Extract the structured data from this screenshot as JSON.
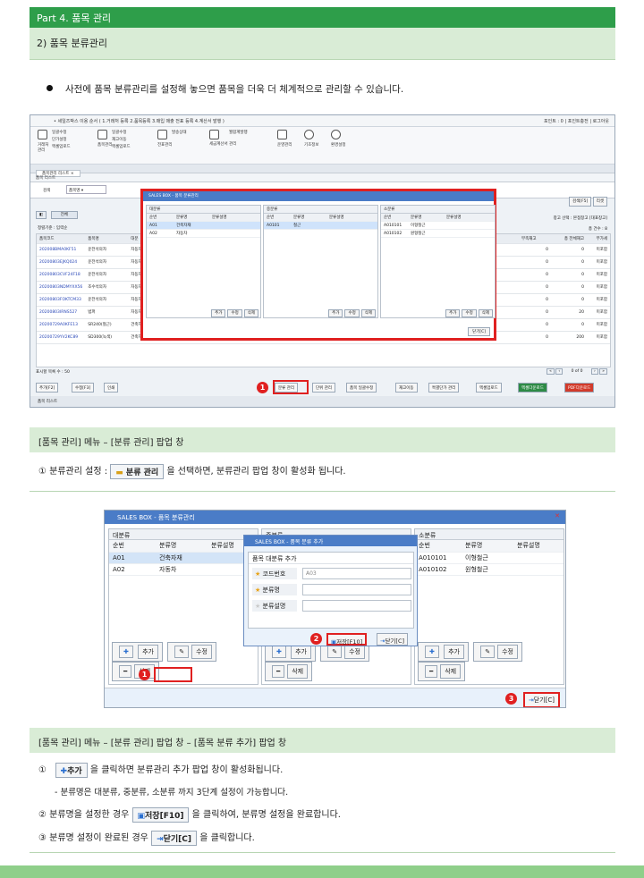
{
  "header": {
    "part_title": "Part 4. 품목 관리",
    "section_title": "2) 품목 분류관리"
  },
  "intro": "사전에 품목 분류관리를 설정해 놓으면 품목을 더욱 더 체계적으로 관리할 수 있습니다.",
  "shot1": {
    "titlebar": "• 세일즈박스 이용 순서 ( 1.거래처 등록 2.품목등록 3.매입 매출 전표 등록 4.계산서 발행 )",
    "titlebar_right": "포인트 : 0  |  포인트충전  |  로그아웃",
    "ribbon": {
      "g1_items": [
        "일괄수정",
        "단가설정",
        "엑셀업로드"
      ],
      "g1_main": "거래처 관리",
      "g2_items": [
        "일괄수정",
        "재고이동",
        "엑셀업로드"
      ],
      "g2_main": "품목관리",
      "g3_main": "전표관리",
      "g3_extra": "발송상태",
      "g4_main": "세금계산서 관리",
      "g4_extra": "월합계발행",
      "g5_main": "운영관리",
      "g6_main": "기초정보",
      "g7_main": "환경설정",
      "labels": [
        "거래처 관리",
        "품목관리",
        "전표관리",
        "세금계산서관리",
        "운영관리",
        "기초정보",
        "환경설정"
      ]
    },
    "tab": "품목관리 리스트",
    "list_head": "품목 리스트",
    "search_label": "검색",
    "search_value": "품목명",
    "all_button": "전체",
    "sort_label": "정렬기준 : 입력순",
    "search_button": "검색[F5]",
    "reset_button": "리셋",
    "warehouse_label": "창고 선택 : 본점창고 [대표창고]",
    "total_label": "총 건수 : 8",
    "grid_headers": [
      "품목코드",
      "품목명",
      "대분"
    ],
    "grid_right_headers": [
      "부족재고",
      "총 전체재고",
      "부가세"
    ],
    "grid_rows": [
      {
        "code": "202008BMA0KF51",
        "name": "운전석의자",
        "cat": "자동차",
        "short": "0",
        "total": "0",
        "vat": "미포함"
      },
      {
        "code": "20200803EJKQ024",
        "name": "운전석의자",
        "cat": "자동차",
        "short": "0",
        "total": "0",
        "vat": "미포함"
      },
      {
        "code": "20200803CVF24F18",
        "name": "운전석의자",
        "cat": "자동차",
        "short": "0",
        "total": "0",
        "vat": "미포함"
      },
      {
        "code": "20200803NDMYXX56",
        "name": "조수석의자",
        "cat": "자동차",
        "short": "0",
        "total": "0",
        "vat": "미포함"
      },
      {
        "code": "20200803FOKTCM33",
        "name": "운전석의자",
        "cat": "자동차",
        "short": "0",
        "total": "0",
        "vat": "미포함"
      },
      {
        "code": "20200803IRNS527",
        "name": "범퍼",
        "cat": "자동차",
        "short": "0",
        "total": "20",
        "vat": "미포함"
      },
      {
        "code": "20200729A0KFE13",
        "name": "SR240(철근)",
        "cat": "건축자재",
        "short": "0",
        "total": "0",
        "vat": "미포함"
      },
      {
        "code": "20200729YV2KC89",
        "name": "SD300(녹색)",
        "cat": "건축자재",
        "short": "0",
        "total": "200",
        "vat": "미포함"
      }
    ],
    "per_page": "표시할 목록 수 : 50",
    "pager": "0 of 0",
    "bottom_buttons": [
      "추가[F2]",
      "수정[F3]",
      "인쇄"
    ],
    "bottom_right_buttons": [
      "분류 관리",
      "단위 관리",
      "품목 일괄수정",
      "재고이동",
      "특별단가 관리",
      "엑셀업로드",
      "엑셀다운로드",
      "PDF다운로드"
    ],
    "status_tab": "품목 리스트",
    "popup": {
      "title": "SALES BOX - 품목 분류관리",
      "columns": [
        {
          "title": "대분류",
          "headers": [
            "순번",
            "분류명",
            "분류설명"
          ],
          "rows": [
            [
              "A01",
              "건축자재",
              ""
            ],
            [
              "A02",
              "자동차",
              ""
            ]
          ]
        },
        {
          "title": "중분류",
          "headers": [
            "순번",
            "분류명",
            "분류설명"
          ],
          "rows": [
            [
              "A0101",
              "철근",
              ""
            ]
          ]
        },
        {
          "title": "소분류",
          "headers": [
            "순번",
            "분류명",
            "분류설명"
          ],
          "rows": [
            [
              "A010101",
              "이형철근",
              ""
            ],
            [
              "A010102",
              "원형철근",
              ""
            ]
          ]
        }
      ],
      "btn_add": "추가",
      "btn_edit": "수정",
      "btn_delete": "삭제",
      "btn_close": "닫기[C]"
    },
    "badge1": "1"
  },
  "section1": {
    "heading": "[품목 관리] 메뉴 – [분류 관리] 팝업 창",
    "line1_prefix": "①  분류관리 설정 :",
    "line1_button": "분류 관리",
    "line1_suffix": "을 선택하면, 분류관리 팝업 창이 활성화 됩니다."
  },
  "shot2": {
    "title": "SALES BOX - 품목 분류관리",
    "columns": [
      {
        "title": "대분류",
        "headers": [
          "순번",
          "분류명",
          "분류설명"
        ],
        "rows": [
          [
            "A01",
            "건축자재",
            ""
          ],
          [
            "A02",
            "자동차",
            ""
          ]
        ]
      },
      {
        "title": "중분류",
        "headers": [
          "순번"
        ],
        "rows": []
      },
      {
        "title": "소분류",
        "headers": [
          "순번",
          "분류명",
          "분류설명"
        ],
        "rows": [
          [
            "A010101",
            "이형철근",
            ""
          ],
          [
            "A010102",
            "원형철근",
            ""
          ]
        ]
      }
    ],
    "btn_add": "추가",
    "btn_edit": "수정",
    "btn_delete": "삭제",
    "btn_close": "닫기[C]",
    "popup": {
      "title": "SALES BOX - 품목 분류 추가",
      "heading": "품목 대분류 추가",
      "fields": [
        {
          "label": "코드번호",
          "value": "A03"
        },
        {
          "label": "분류명",
          "value": ""
        },
        {
          "label": "분류설명",
          "value": ""
        }
      ],
      "save": "저장[F10]",
      "close": "닫기[C]"
    },
    "badges": [
      "1",
      "2",
      "3"
    ]
  },
  "section2": {
    "heading": "[품목 관리] 메뉴 – [분류 관리] 팝업 창 – [품목 분류 추가] 팝업 창",
    "l1_prefix": "①",
    "l1_button": "추가",
    "l1_suffix": "을 클릭하면 분류관리 추가 팝업 창이 활성화됩니다.",
    "l2": "-  분류명은 대분류, 중분류, 소분류 까지 3단계 설정이 가능합니다.",
    "l3_prefix": "②  분류명을 설정한 경우",
    "l3_button": "저장[F10]",
    "l3_suffix": "을 클릭하여, 분류명 설정을 완료합니다.",
    "l4_prefix": "③  분류명 설정이 완료된 경우",
    "l4_button": "닫기[C]",
    "l4_suffix": "을 클릭합니다."
  }
}
